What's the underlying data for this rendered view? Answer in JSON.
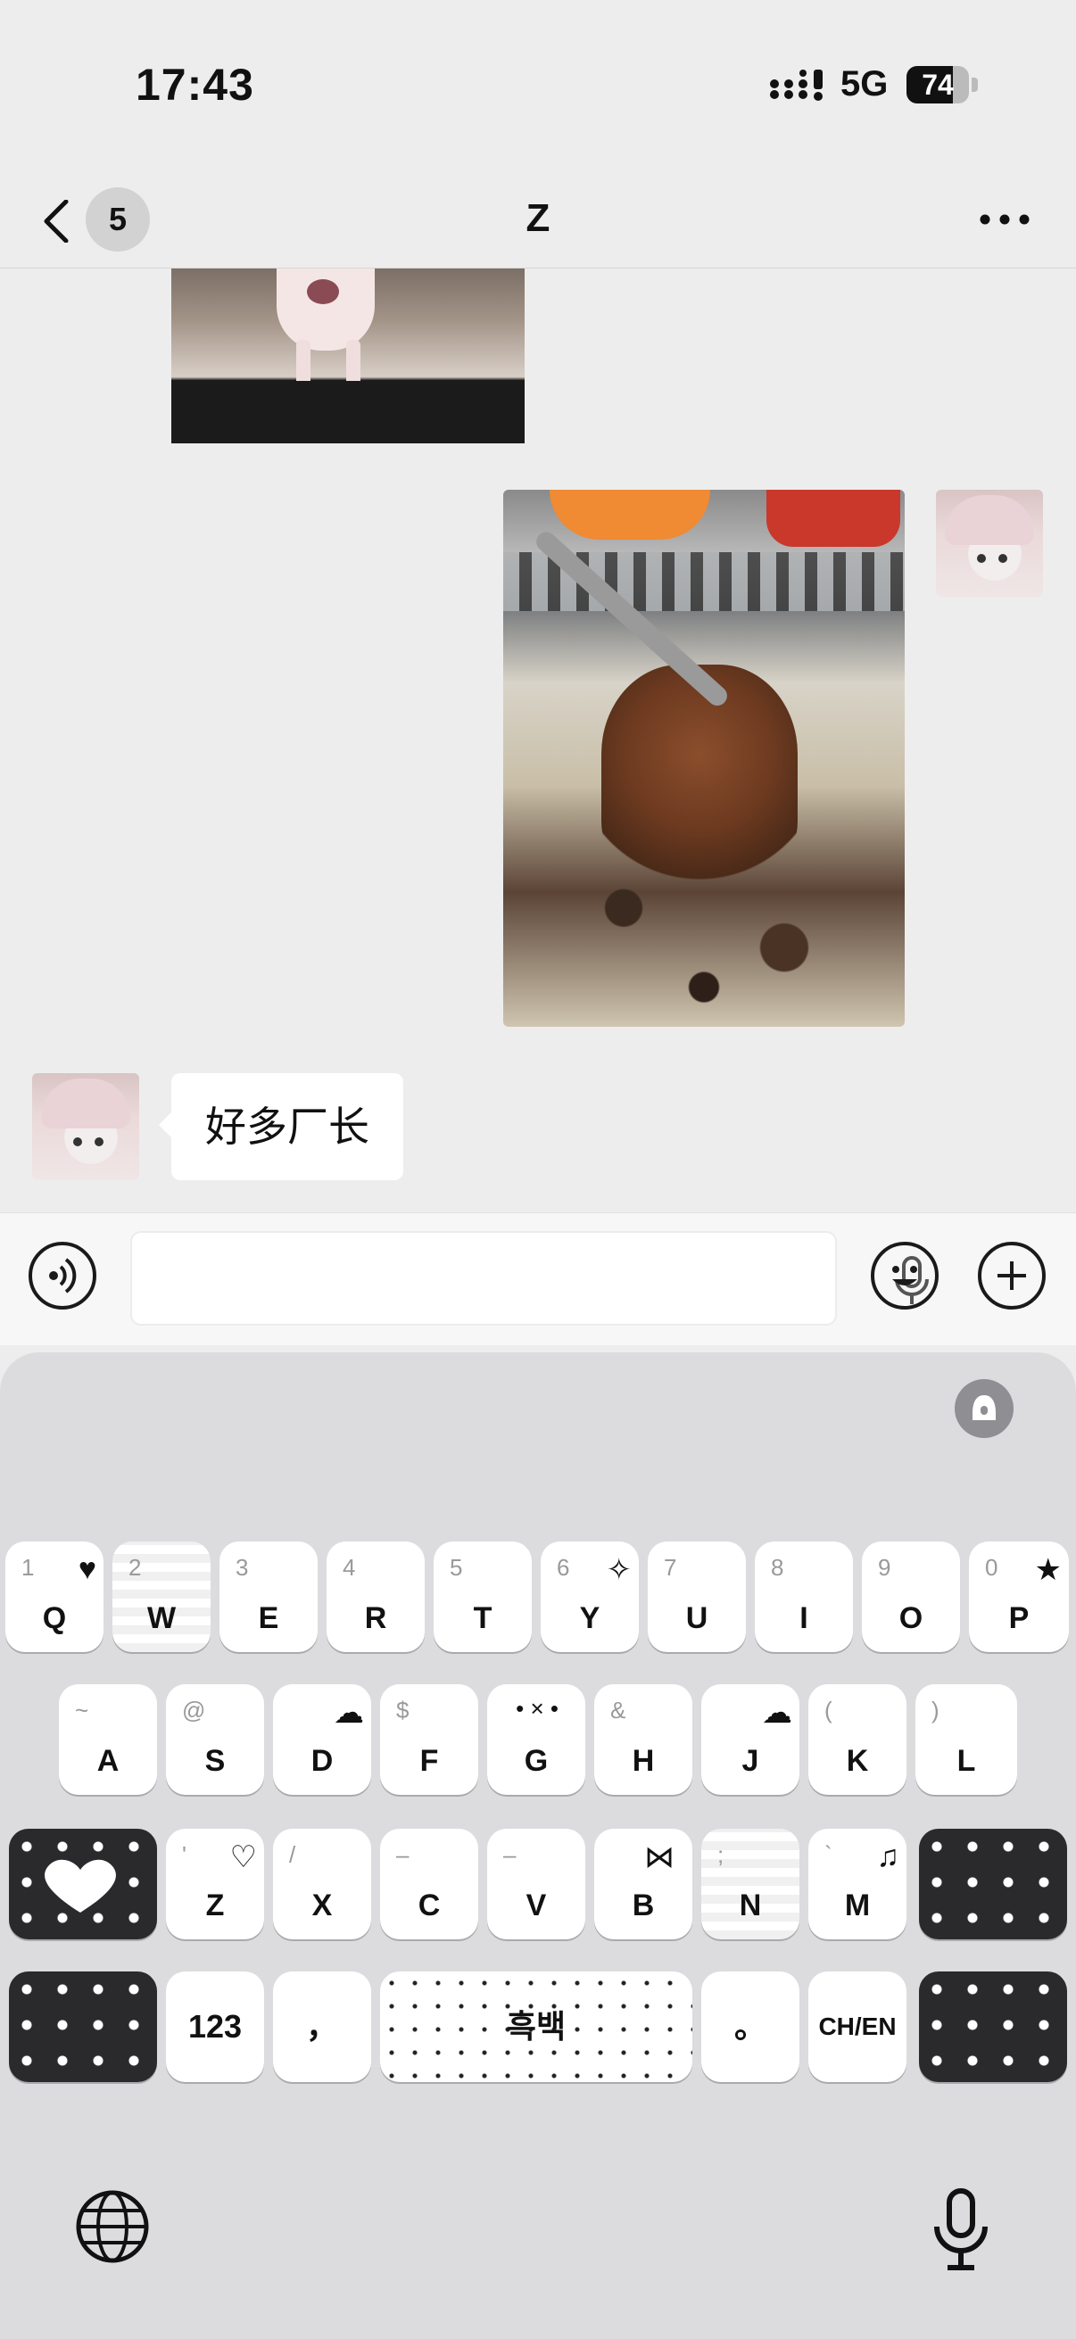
{
  "status_bar": {
    "time": "17:43",
    "network": "5G",
    "battery": "74",
    "battery_level": 0.74
  },
  "nav": {
    "badge_count": "5",
    "title": "Z"
  },
  "chat": {
    "messages": [
      {
        "type": "image",
        "side": "other",
        "content": "kitten-photo"
      },
      {
        "type": "image",
        "side": "self",
        "content": "grilled-meat-photo"
      },
      {
        "type": "text",
        "side": "other",
        "text": "好多厂长"
      }
    ]
  },
  "input": {
    "value": "",
    "placeholder": ""
  },
  "keyboard": {
    "row1": [
      {
        "letter": "Q",
        "hint": "1"
      },
      {
        "letter": "W",
        "hint": "2"
      },
      {
        "letter": "E",
        "hint": "3"
      },
      {
        "letter": "R",
        "hint": "4"
      },
      {
        "letter": "T",
        "hint": "5"
      },
      {
        "letter": "Y",
        "hint": "6"
      },
      {
        "letter": "U",
        "hint": "7"
      },
      {
        "letter": "I",
        "hint": "8"
      },
      {
        "letter": "O",
        "hint": "9"
      },
      {
        "letter": "P",
        "hint": "0"
      }
    ],
    "row2": [
      {
        "letter": "A",
        "hint": "~"
      },
      {
        "letter": "S",
        "hint": "@"
      },
      {
        "letter": "D",
        "hint": ""
      },
      {
        "letter": "F",
        "hint": "$"
      },
      {
        "letter": "G",
        "hint": ""
      },
      {
        "letter": "H",
        "hint": "&"
      },
      {
        "letter": "J",
        "hint": ""
      },
      {
        "letter": "K",
        "hint": "("
      },
      {
        "letter": "L",
        "hint": ")"
      }
    ],
    "row3": [
      {
        "letter": "Z",
        "hint": "'"
      },
      {
        "letter": "X",
        "hint": "/"
      },
      {
        "letter": "C",
        "hint": "–"
      },
      {
        "letter": "V",
        "hint": "–"
      },
      {
        "letter": "B",
        "hint": ""
      },
      {
        "letter": "N",
        "hint": ";"
      },
      {
        "letter": "M",
        "hint": "`"
      }
    ],
    "numbers_key": "123",
    "comma_key": "，",
    "space_key": "흑백",
    "period_key": "。",
    "lang_key": "CH/EN"
  },
  "colors": {
    "background": "#ededed",
    "keyboard_bg": "#dcdcdf",
    "bubble": "#ffffff"
  }
}
